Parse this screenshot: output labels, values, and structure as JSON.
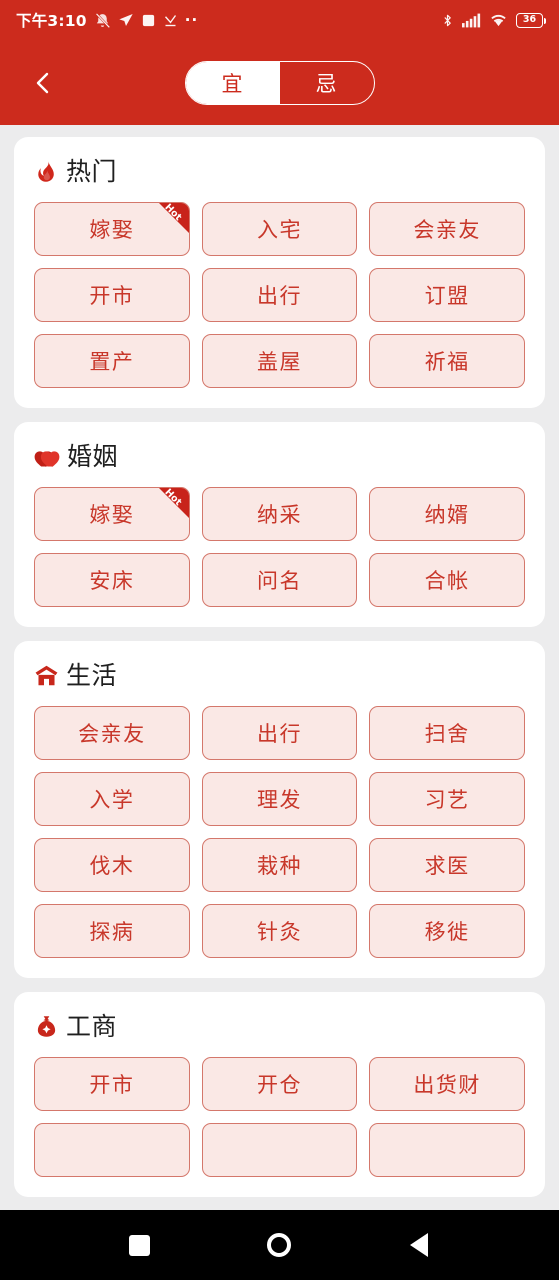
{
  "statusbar": {
    "time": "下午3:10",
    "battery_level": "36",
    "icons_left": [
      "bell-muted-icon",
      "paper-plane-icon",
      "square-app-icon",
      "download-check-icon",
      "more-dots-icon"
    ],
    "icons_right": [
      "bluetooth-icon",
      "cellular-signal-icon",
      "wifi-icon",
      "battery-icon"
    ],
    "dots": "··"
  },
  "appbar": {
    "back_icon": "chevron-left-icon",
    "toggle": {
      "active_label": "宜",
      "inactive_label": "忌",
      "selected": "宜"
    }
  },
  "theme": {
    "brand_red": "#cc2b1d",
    "chip_bg": "#fae8e5",
    "chip_border": "#d4776b",
    "chip_text": "#c8372a",
    "page_bg": "#ececed",
    "card_bg": "#ffffff"
  },
  "sections": [
    {
      "id": "hot",
      "title": "热门",
      "icon": "flame-icon",
      "items": [
        {
          "label": "嫁娶",
          "badge": "Hot"
        },
        {
          "label": "入宅"
        },
        {
          "label": "会亲友"
        },
        {
          "label": "开市"
        },
        {
          "label": "出行"
        },
        {
          "label": "订盟"
        },
        {
          "label": "置产"
        },
        {
          "label": "盖屋"
        },
        {
          "label": "祈福"
        }
      ]
    },
    {
      "id": "marriage",
      "title": "婚姻",
      "icon": "double-heart-icon",
      "items": [
        {
          "label": "嫁娶",
          "badge": "Hot"
        },
        {
          "label": "纳采"
        },
        {
          "label": "纳婿"
        },
        {
          "label": "安床"
        },
        {
          "label": "问名"
        },
        {
          "label": "合帐"
        }
      ]
    },
    {
      "id": "life",
      "title": "生活",
      "icon": "house-icon",
      "items": [
        {
          "label": "会亲友"
        },
        {
          "label": "出行"
        },
        {
          "label": "扫舍"
        },
        {
          "label": "入学"
        },
        {
          "label": "理发"
        },
        {
          "label": "习艺"
        },
        {
          "label": "伐木"
        },
        {
          "label": "栽种"
        },
        {
          "label": "求医"
        },
        {
          "label": "探病"
        },
        {
          "label": "针灸"
        },
        {
          "label": "移徙"
        }
      ]
    },
    {
      "id": "business",
      "title": "工商",
      "icon": "money-bag-icon",
      "items": [
        {
          "label": "开市"
        },
        {
          "label": "开仓"
        },
        {
          "label": "出货财"
        },
        {
          "label": ""
        },
        {
          "label": ""
        },
        {
          "label": ""
        }
      ]
    }
  ],
  "navbar": {
    "recents_icon": "square-icon",
    "home_icon": "circle-icon",
    "back_icon": "triangle-back-icon"
  }
}
